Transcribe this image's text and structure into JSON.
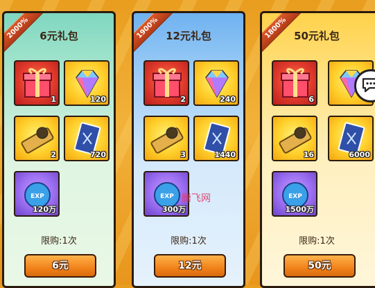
{
  "packs": [
    {
      "badge": "2000%",
      "title": "6元礼包",
      "items": [
        {
          "icon": "gift-box-icon",
          "qty": "1"
        },
        {
          "icon": "rainbow-diamond-icon",
          "qty": "120"
        },
        {
          "icon": "gold-ticket-icon",
          "qty": "2"
        },
        {
          "icon": "card-pack-icon",
          "qty": "720"
        },
        {
          "icon": "exp-potion-icon",
          "qty": "120万"
        }
      ],
      "limit": "限购:1次",
      "price_label": "6元"
    },
    {
      "badge": "1900%",
      "title": "12元礼包",
      "items": [
        {
          "icon": "gift-box-icon",
          "qty": "2"
        },
        {
          "icon": "rainbow-diamond-icon",
          "qty": "240"
        },
        {
          "icon": "gold-ticket-icon",
          "qty": "3"
        },
        {
          "icon": "card-pack-icon",
          "qty": "1440"
        },
        {
          "icon": "exp-potion-icon",
          "qty": "300万"
        }
      ],
      "limit": "限购:1次",
      "price_label": "12元"
    },
    {
      "badge": "1800%",
      "title": "50元礼包",
      "items": [
        {
          "icon": "gift-box-icon",
          "qty": "6"
        },
        {
          "icon": "rainbow-diamond-icon",
          "qty": ""
        },
        {
          "icon": "gold-ticket-icon",
          "qty": "16"
        },
        {
          "icon": "card-pack-icon",
          "qty": "6000"
        },
        {
          "icon": "exp-potion-icon",
          "qty": "1500万"
        }
      ],
      "limit": "限购:1次",
      "price_label": "50元"
    }
  ],
  "watermark": "腾飞网",
  "chat_icon": "chat-bubble-icon"
}
